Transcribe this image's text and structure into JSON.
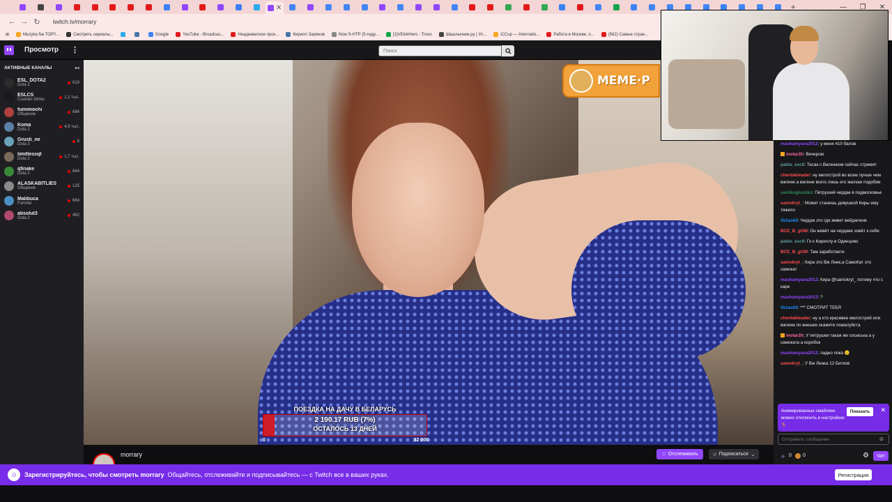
{
  "browser": {
    "url": "twitch.tv/morrary",
    "tab_colors": [
      "#9147ff",
      "#444444",
      "#9147ff",
      "#e11a1a",
      "#e11a1a",
      "#e11a1a",
      "#e11a1a",
      "#e11a1a",
      "#3b82f6",
      "#9147ff",
      "#e11a1a",
      "#9147ff",
      "#3b82f6",
      "#2aabee",
      "#9147ff",
      "#4285f4",
      "#9147ff",
      "#4285f4",
      "#4285f4",
      "#4285f4",
      "#9147ff",
      "#4285f4",
      "#9147ff",
      "#9147ff",
      "#4285f4",
      "#e11a1a",
      "#e11a1a",
      "#34a853",
      "#e11a1a",
      "#34a853",
      "#3b82f6",
      "#e11a1a",
      "#4285f4",
      "#16a34a",
      "#3b82f6",
      "#4285f4",
      "#4285f4",
      "#4285f4",
      "#4285f4",
      "#3b82f6",
      "#4285f4",
      "#4285f4",
      "#4285f4"
    ],
    "active_tab_index": 14,
    "bookmarks": [
      {
        "label": "Muzyka Na TOP!!...",
        "color": "#f5a623"
      },
      {
        "label": "Смотреть сериалы...",
        "color": "#333333"
      },
      {
        "label": "",
        "color": "#2aabee"
      },
      {
        "label": "",
        "color": "#4a76a8"
      },
      {
        "label": "Google",
        "color": "#4285f4"
      },
      {
        "label": "YouTube - Broadcas...",
        "color": "#e11a1a"
      },
      {
        "label": "Неадекватное прох...",
        "color": "#e11a1a"
      },
      {
        "label": "Кирилл Зарянов",
        "color": "#4a76a8"
      },
      {
        "label": "Now S-HTP (5-гидр...",
        "color": "#888888"
      },
      {
        "label": "[1]VEinkHero - Trovo",
        "color": "#16a34a"
      },
      {
        "label": "Шашлычник.ру | Ул...",
        "color": "#444444"
      },
      {
        "label": "iCCup — Internatio...",
        "color": "#f5a623"
      },
      {
        "label": "Работа в Москве, п...",
        "color": "#e11a1a"
      },
      {
        "label": "(562) Самые стран...",
        "color": "#e11a1a"
      }
    ]
  },
  "nav": {
    "browse": "Просмотр",
    "more": "⋮",
    "search_placeholder": "Поиск"
  },
  "sidebar": {
    "title": "АКТИВНЫЕ КАНАЛЫ",
    "channels": [
      {
        "name": "ESL_DOTA2",
        "game": "Dota 2",
        "viewers": "619",
        "color": "#2b2b2b"
      },
      {
        "name": "ESLCS",
        "game": "Counter-Strike",
        "viewers": "1,1 тыс.",
        "color": "#1a1a1a"
      },
      {
        "name": "fumimochi",
        "game": "Общение",
        "viewers": "684",
        "color": "#b0413e"
      },
      {
        "name": "Koma",
        "game": "Dota 2",
        "viewers": "4,9 тыс.",
        "color": "#5b7fa6"
      },
      {
        "name": "Grusti_ne",
        "game": "Dota 2",
        "viewers": "8",
        "color": "#6aa3b8"
      },
      {
        "name": "limitlessqt",
        "game": "Dota 2",
        "viewers": "1,7 тыс.",
        "color": "#7a6a5a"
      },
      {
        "name": "q5nake",
        "game": "Dota 2",
        "viewers": "644",
        "color": "#3a8a3a"
      },
      {
        "name": "ALASKABITLIES",
        "game": "Общение",
        "viewers": "125",
        "color": "#8a8a8a"
      },
      {
        "name": "Malibuca",
        "game": "Fortnite",
        "viewers": "664",
        "color": "#4a90c2"
      },
      {
        "name": "absolut3",
        "game": "Dota 2",
        "viewers": "462",
        "color": "#b04a6a"
      }
    ]
  },
  "video": {
    "meme_banner": "MEME·P",
    "goal": {
      "title": "ПОЕЗДКА НА ДАЧУ В БЕЛАРУСЬ",
      "amount": "2 190.17 RUB (7%)",
      "remaining": "ОСТАЛОСЬ 13 ДНЕЙ",
      "min": "0",
      "max": "32 000",
      "progress": 0.07
    }
  },
  "channel": {
    "name": "morrary",
    "follow": "Отслеживать",
    "subscribe": "Подписаться"
  },
  "chat": {
    "messages": [
      {
        "user": "mashamyava2012",
        "text": "у меня 410 балов",
        "color": "#9147ff",
        "badge": false
      },
      {
        "user": "motar2h",
        "text": "Вечером",
        "color": "#ff6b9d",
        "badge": true
      },
      {
        "user": "pablo_esc9",
        "text": "Тесак с Вжлинком сейчас стримят",
        "color": "#5f9ea0",
        "badge": false
      },
      {
        "user": "cherdakleader",
        "text": "ну меллстрой во всем лучше чем вжлинк а вжлинк всего лишь его жалкая подобие",
        "color": "#ff4d4d",
        "badge": false
      },
      {
        "user": "sashkoglushko",
        "text": "Петруший чердак в подмосковье",
        "color": "#2e8b57",
        "badge": false
      },
      {
        "user": "samokryt_",
        "text": "Может станешь девушкой Киры ему тяжело",
        "color": "#ff4d4d",
        "badge": false
      },
      {
        "user": "Ve1ask0",
        "text": "Чердак это где живет вейджлинк",
        "color": "#1e90ff",
        "badge": false
      },
      {
        "user": "BCE_B_gOM",
        "text": "Он живёт на чердаке зовёт к себе",
        "color": "#ff4d4d",
        "badge": false
      },
      {
        "user": "pablo_esc9",
        "text": "Го к Кириллу в Одинцово",
        "color": "#5f9ea0",
        "badge": false
      },
      {
        "user": "BCE_B_gOM",
        "text": "Там заработаете",
        "color": "#ff4d4d",
        "badge": false
      },
      {
        "user": "samokryt_",
        "text": "Кира это Вж Линк,а СамоКат это самокат",
        "color": "#ff4d4d",
        "badge": false
      },
      {
        "user": "mashamyava2012",
        "text": "Кира @samokryt_ потому что с каре",
        "color": "#9147ff",
        "badge": false
      },
      {
        "user": "mashamyava2012",
        "text": "?",
        "color": "#9147ff",
        "badge": false
      },
      {
        "user": "Ve1ask0",
        "text": "*** СМОТРИТ ТЕБЯ",
        "color": "#1e90ff",
        "badge": false
      },
      {
        "user": "cherdakleader",
        "text": "ну а кто красивее меллстрой или вжлинк по внешке скажите пожалуйста",
        "color": "#ff4d4d",
        "badge": false
      },
      {
        "user": "motar2h",
        "text": "У петрушки такая же сосиська а у самоката а коробок",
        "color": "#ff6b9d",
        "badge": true
      },
      {
        "user": "mashamyava2012",
        "text": "ладно пока 😊",
        "color": "#9147ff",
        "badge": false
      },
      {
        "user": "samokryt_",
        "text": "У Вж Линка 12 Битков",
        "color": "#ff4d4d",
        "badge": false
      }
    ],
    "notice": "Анимированные смайлики можно отключить в настройках 🦌",
    "notice_show": "Показать",
    "input_placeholder": "Отправить сообщение",
    "points": "0",
    "bits": "0",
    "send": "Чат"
  },
  "signup": {
    "bold": "Зарегистрируйтесь, чтобы смотреть morrary",
    "text": "Общайтесь, отслеживайте и подписывайтесь — с Twitch все в ваших руках.",
    "button": "Регистрация"
  }
}
